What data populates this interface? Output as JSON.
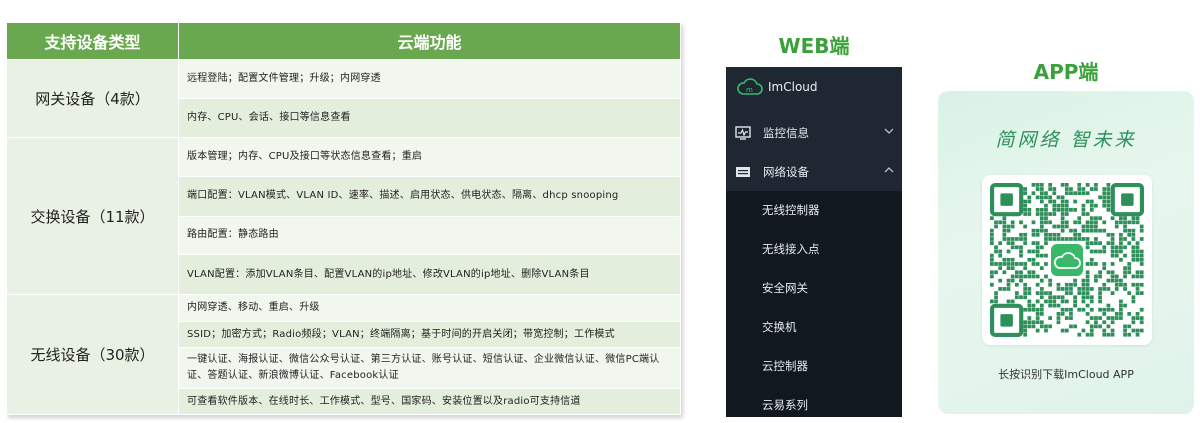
{
  "table": {
    "headers": [
      "支持设备类型",
      "云端功能"
    ],
    "groups": [
      {
        "type": "网关设备（4款）",
        "features": [
          "远程登陆；配置文件管理；升级；内网穿透",
          "内存、CPU、会话、接口等信息查看"
        ]
      },
      {
        "type": "交换设备（11款）",
        "features": [
          "版本管理；内存、CPU及接口等状态信息查看；重启",
          "端口配置：VLAN模式、VLAN ID、速率、描述、启用状态、供电状态、隔离、dhcp snooping",
          "路由配置：静态路由",
          "VLAN配置：添加VLAN条目、配置VLAN的ip地址、修改VLAN的ip地址、删除VLAN条目"
        ]
      },
      {
        "type": "无线设备（30款）",
        "features": [
          "内网穿透、移动、重启、升级",
          "SSID；加密方式；Radio频段；VLAN；终端隔离；基于时间的开启关闭；带宽控制；工作模式",
          "一键认证、海报认证、微信公众号认证、第三方认证、账号认证、短信认证、企业微信认证、微信PC端认证、答题认证、新浪微博认证、Facebook认证",
          "可查看软件版本、在线时长、工作模式、型号、国家码、安装位置以及radio可支持信道"
        ]
      }
    ]
  },
  "web": {
    "title": "WEB端",
    "brand": "ImCloud",
    "menu": [
      {
        "label": "监控信息",
        "icon": "monitor-icon",
        "expanded": false
      },
      {
        "label": "网络设备",
        "icon": "device-icon",
        "expanded": true
      }
    ],
    "submenu": [
      "无线控制器",
      "无线接入点",
      "安全网关",
      "交换机",
      "云控制器",
      "云易系列"
    ]
  },
  "app": {
    "title": "APP端",
    "slogan": "简网络 智未来",
    "caption": "长按识别下载ImCloud APP"
  },
  "colors": {
    "header_green": "#6aa84f",
    "title_green": "#3aa13a",
    "sidebar_bg": "#1f2733",
    "submenu_bg": "#121820",
    "qr_green": "#2f8f5b"
  }
}
